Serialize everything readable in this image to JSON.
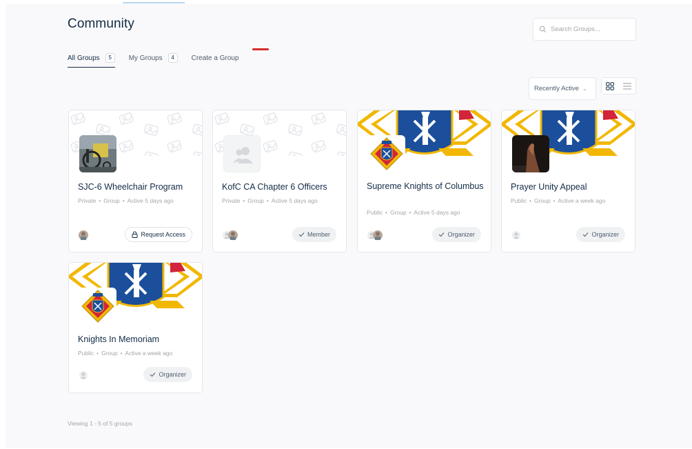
{
  "page": {
    "title": "Community"
  },
  "search": {
    "placeholder": "Search Groups..."
  },
  "tabs": [
    {
      "label": "All Groups",
      "count": "5"
    },
    {
      "label": "My Groups",
      "count": "4"
    },
    {
      "label": "Create a Group"
    }
  ],
  "sort": {
    "selected": "Recently Active"
  },
  "view_modes": [
    "grid-view-icon",
    "list-view-icon"
  ],
  "groups": [
    {
      "title": "SJC-6 Wheelchair Program",
      "privacy": "Private",
      "type": "Group",
      "activity": "Active 5 days ago",
      "action": "Request Access",
      "action_icon": "lock-icon"
    },
    {
      "title": "KofC CA Chapter 6 Officers",
      "privacy": "Private",
      "type": "Group",
      "activity": "Active 5 days ago",
      "action": "Member",
      "action_icon": "check-icon"
    },
    {
      "title": "Supreme Knights of Columbus",
      "privacy": "Public",
      "type": "Group",
      "activity": "Active 5 days ago",
      "action": "Organizer",
      "action_icon": "check-icon"
    },
    {
      "title": "Prayer Unity Appeal",
      "privacy": "Public",
      "type": "Group",
      "activity": "Active a week ago",
      "action": "Organizer",
      "action_icon": "check-icon"
    },
    {
      "title": "Knights In Memoriam",
      "privacy": "Public",
      "type": "Group",
      "activity": "Active a week ago",
      "action": "Organizer",
      "action_icon": "check-icon"
    }
  ],
  "footer": {
    "viewing": "Viewing 1 - 5 of 5 groups"
  },
  "colors": {
    "accent_red": "#d22b2b",
    "text_primary": "#122b46",
    "text_muted": "#a3a5a9",
    "kofc_blue": "#1b4f9c",
    "kofc_gold": "#f2b705"
  }
}
